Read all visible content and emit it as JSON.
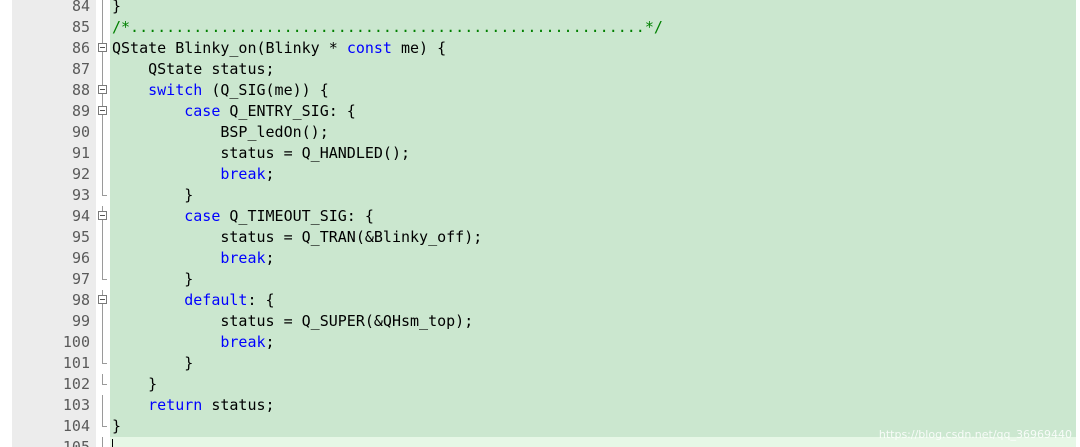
{
  "editor": {
    "lines": [
      {
        "num": "84",
        "fold": "vline",
        "tokens": [
          {
            "t": "}",
            "c": ""
          }
        ]
      },
      {
        "num": "85",
        "fold": "vline",
        "tokens": [
          {
            "t": "/*.........................................................*/",
            "c": "cm"
          }
        ]
      },
      {
        "num": "86",
        "fold": "box",
        "tokens": [
          {
            "t": "QState Blinky_on(Blinky * ",
            "c": ""
          },
          {
            "t": "const",
            "c": "kw"
          },
          {
            "t": " me) {",
            "c": ""
          }
        ]
      },
      {
        "num": "87",
        "fold": "vline",
        "tokens": [
          {
            "t": "    QState status;",
            "c": ""
          }
        ]
      },
      {
        "num": "88",
        "fold": "box",
        "tokens": [
          {
            "t": "    ",
            "c": ""
          },
          {
            "t": "switch",
            "c": "kw"
          },
          {
            "t": " (Q_SIG(me)) {",
            "c": ""
          }
        ]
      },
      {
        "num": "89",
        "fold": "box",
        "tokens": [
          {
            "t": "        ",
            "c": ""
          },
          {
            "t": "case",
            "c": "kw"
          },
          {
            "t": " Q_ENTRY_SIG: {",
            "c": ""
          }
        ]
      },
      {
        "num": "90",
        "fold": "vline",
        "tokens": [
          {
            "t": "            BSP_ledOn();",
            "c": ""
          }
        ]
      },
      {
        "num": "91",
        "fold": "vline",
        "tokens": [
          {
            "t": "            status = Q_HANDLED();",
            "c": ""
          }
        ]
      },
      {
        "num": "92",
        "fold": "vline",
        "tokens": [
          {
            "t": "            ",
            "c": ""
          },
          {
            "t": "break",
            "c": "kw"
          },
          {
            "t": ";",
            "c": ""
          }
        ]
      },
      {
        "num": "93",
        "fold": "end",
        "tokens": [
          {
            "t": "        }",
            "c": ""
          }
        ]
      },
      {
        "num": "94",
        "fold": "box",
        "tokens": [
          {
            "t": "        ",
            "c": ""
          },
          {
            "t": "case",
            "c": "kw"
          },
          {
            "t": " Q_TIMEOUT_SIG: {",
            "c": ""
          }
        ]
      },
      {
        "num": "95",
        "fold": "vline",
        "tokens": [
          {
            "t": "            status = Q_TRAN(&Blinky_off);",
            "c": ""
          }
        ]
      },
      {
        "num": "96",
        "fold": "vline",
        "tokens": [
          {
            "t": "            ",
            "c": ""
          },
          {
            "t": "break",
            "c": "kw"
          },
          {
            "t": ";",
            "c": ""
          }
        ]
      },
      {
        "num": "97",
        "fold": "end",
        "tokens": [
          {
            "t": "        }",
            "c": ""
          }
        ]
      },
      {
        "num": "98",
        "fold": "box",
        "tokens": [
          {
            "t": "        ",
            "c": ""
          },
          {
            "t": "default",
            "c": "kw"
          },
          {
            "t": ": {",
            "c": ""
          }
        ]
      },
      {
        "num": "99",
        "fold": "vline",
        "tokens": [
          {
            "t": "            status = Q_SUPER(&QHsm_top);",
            "c": ""
          }
        ]
      },
      {
        "num": "100",
        "fold": "vline",
        "tokens": [
          {
            "t": "            ",
            "c": ""
          },
          {
            "t": "break",
            "c": "kw"
          },
          {
            "t": ";",
            "c": ""
          }
        ]
      },
      {
        "num": "101",
        "fold": "end",
        "tokens": [
          {
            "t": "        }",
            "c": ""
          }
        ]
      },
      {
        "num": "102",
        "fold": "end",
        "tokens": [
          {
            "t": "    }",
            "c": ""
          }
        ]
      },
      {
        "num": "103",
        "fold": "vline",
        "tokens": [
          {
            "t": "    ",
            "c": ""
          },
          {
            "t": "return",
            "c": "kw"
          },
          {
            "t": " status;",
            "c": ""
          }
        ]
      },
      {
        "num": "104",
        "fold": "end",
        "tokens": [
          {
            "t": "}",
            "c": ""
          }
        ]
      },
      {
        "num": "105",
        "fold": "end",
        "current": true,
        "tokens": []
      }
    ]
  },
  "watermark": "https://blog.csdn.net/qq_36969440",
  "colors": {
    "background": "#cbe7cf",
    "keyword": "#0000ff",
    "comment": "#008000",
    "line_number": "#5a5a5a",
    "current_line": "#e6f7e6"
  }
}
